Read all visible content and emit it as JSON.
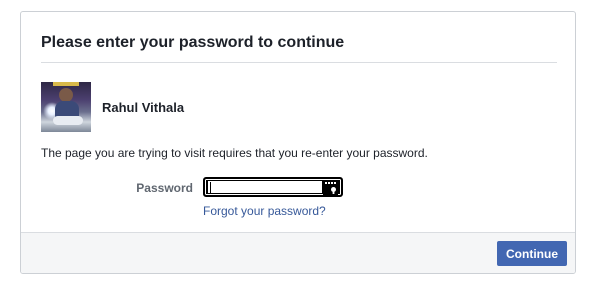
{
  "dialog": {
    "title": "Please enter your password to continue"
  },
  "profile": {
    "name": "Rahul Vithala",
    "avatar_icon": "user-photo"
  },
  "message": "The page you are trying to visit requires that you re-enter your password.",
  "form": {
    "password_label": "Password",
    "password_value": "",
    "password_placeholder": "",
    "forgot_link": "Forgot your password?",
    "key_icon": "password-manager-key-icon"
  },
  "footer": {
    "continue_label": "Continue"
  },
  "colors": {
    "accent": "#4267b2",
    "link": "#365899",
    "text": "#1d2129",
    "label": "#606770",
    "footer_bg": "#f5f6f7",
    "border": "#ccd0d5"
  }
}
